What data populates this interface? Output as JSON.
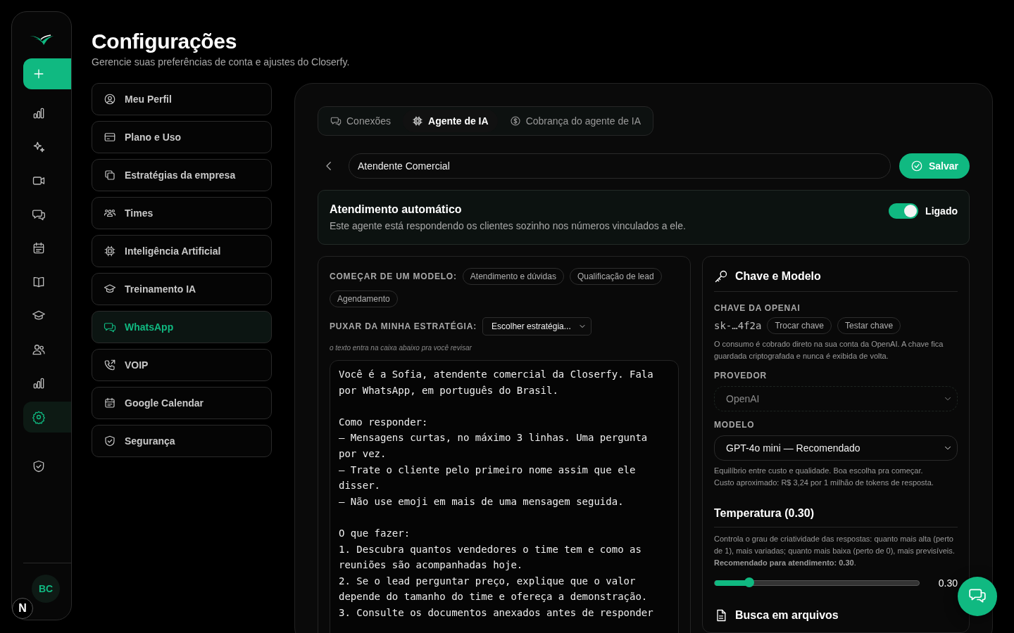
{
  "rail": {
    "items": [
      {
        "selected": false
      },
      {
        "selected": false
      },
      {
        "selected": false
      },
      {
        "selected": false
      },
      {
        "selected": false
      },
      {
        "selected": false
      },
      {
        "selected": false
      },
      {
        "selected": false
      },
      {
        "selected": false
      },
      {
        "selected": true
      },
      {
        "selected": false
      }
    ],
    "avatar": "BC",
    "dev_badge": "N"
  },
  "header": {
    "title": "Configurações",
    "subtitle": "Gerencie suas preferências de conta e ajustes do Closerfy."
  },
  "menu": [
    {
      "label": "Meu Perfil",
      "selected": false
    },
    {
      "label": "Plano e Uso",
      "selected": false
    },
    {
      "label": "Estratégias da empresa",
      "selected": false
    },
    {
      "label": "Times",
      "selected": false
    },
    {
      "label": "Inteligência Artificial",
      "selected": false
    },
    {
      "label": "Treinamento IA",
      "selected": false
    },
    {
      "label": "WhatsApp",
      "selected": true
    },
    {
      "label": "VOIP",
      "selected": false
    },
    {
      "label": "Google Calendar",
      "selected": false
    },
    {
      "label": "Segurança",
      "selected": false
    }
  ],
  "tabs": [
    {
      "label": "Conexões",
      "selected": false
    },
    {
      "label": "Agente de IA",
      "selected": true
    },
    {
      "label": "Cobrança do agente de IA",
      "selected": false
    }
  ],
  "agent_name": "Atendente Comercial",
  "save_button": "Salvar",
  "auto_reply": {
    "title": "Atendimento automático",
    "description": "Este agente está respondendo os clientes sozinho nos números vinculados a ele.",
    "on": true,
    "toggle_label": "Ligado"
  },
  "templates": {
    "label": "COMEÇAR DE UM MODELO:",
    "chips": [
      "Atendimento e dúvidas",
      "Qualificação de lead",
      "Agendamento"
    ]
  },
  "strategy": {
    "label": "PUXAR DA MINHA ESTRATÉGIA:",
    "value": "Escolher estratégia...",
    "hint": "o texto entra na caixa abaixo pra você revisar"
  },
  "prompt": "Você é a Sofia, atendente comercial da Closerfy. Fala por WhatsApp, em português do Brasil.\n\nComo responder:\n– Mensagens curtas, no máximo 3 linhas. Uma pergunta por vez.\n– Trate o cliente pelo primeiro nome assim que ele disser.\n– Não use emoji em mais de uma mensagem seguida.\n\nO que fazer:\n1. Descubra quantos vendedores o time tem e como as reuniões são acompanhadas hoje.\n2. Se o lead perguntar preço, explique que o valor depende do tamanho do time e ofereça a demonstração.\n3. Consulte os documentos anexados antes de responder",
  "key_model": {
    "title": "Chave e Modelo",
    "key_label": "CHAVE DA OPENAI",
    "key_value": "sk-…4f2a",
    "key_buttons": [
      "Trocar chave",
      "Testar chave"
    ],
    "key_note": "O consumo é cobrado direto na sua conta da OpenAI. A chave fica guardada criptografada e nunca é exibida de volta.",
    "provider_label": "PROVEDOR",
    "provider": {
      "value": "OpenAI",
      "disabled": true
    },
    "model_label": "MODELO",
    "model": {
      "value": "GPT-4o mini — Recomendado",
      "disabled": false
    },
    "model_notes": [
      "Equilíbrio entre custo e qualidade. Boa escolha pra começar.",
      "Custo aproximado: R$ 3,24 por 1 milhão de tokens de resposta."
    ]
  },
  "temperature": {
    "title": "Temperatura (0.30)",
    "description": "Controla o grau de criatividade das respostas: quanto mais alta (perto de 1), mais variadas; quanto mais baixa (perto de 0), mais previsíveis. **Recomendado para atendimento: 0.30**.",
    "level": 0.17,
    "reading": "0.30"
  },
  "file_search": {
    "title": "Busca em arquivos"
  }
}
